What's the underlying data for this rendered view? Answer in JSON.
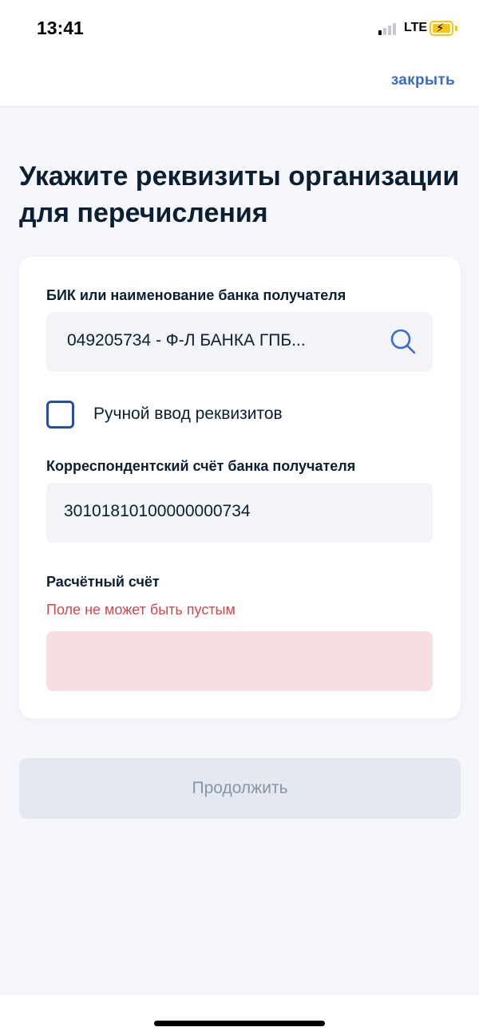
{
  "status_bar": {
    "time": "13:41",
    "network": "LTE",
    "signal_bars_active": 1,
    "signal_bars_total": 4,
    "battery_state": "charging"
  },
  "nav": {
    "close_label": "закрыть"
  },
  "page": {
    "title": "Укажите реквизиты организации для перечисления"
  },
  "form": {
    "bank": {
      "label": "БИК или наименование банка получателя",
      "value": "049205734 - Ф-Л БАНКА ГПБ...",
      "icon": "search-icon"
    },
    "manual_entry": {
      "label": "Ручной ввод реквизитов",
      "checked": false
    },
    "corr_account": {
      "label": "Корреспондентский счёт банка получателя",
      "value": "30101810100000000734"
    },
    "settlement_account": {
      "label": "Расчётный счёт",
      "error": "Поле не может быть пустым",
      "value": ""
    }
  },
  "actions": {
    "continue_label": "Продолжить",
    "continue_enabled": false
  },
  "colors": {
    "accent": "#3a6bc7",
    "checkbox_border": "#2c4ea0",
    "error_text": "#d0474d",
    "error_field_bg": "#f7dfe1",
    "page_bg": "#f6f7fc",
    "disabled_button_bg": "#e4e8f0"
  }
}
